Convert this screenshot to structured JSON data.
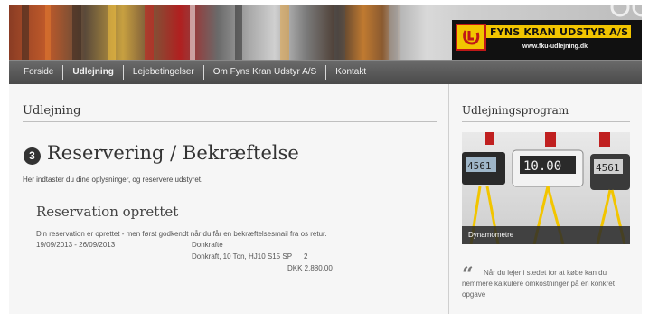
{
  "header": {
    "brand_name": "FYNS KRAN UDSTYR A/S",
    "brand_url": "www.fku-udlejning.dk"
  },
  "nav": {
    "items": [
      {
        "label": "Forside"
      },
      {
        "label": "Udlejning"
      },
      {
        "label": "Lejebetingelser"
      },
      {
        "label": "Om Fyns Kran Udstyr A/S"
      },
      {
        "label": "Kontakt"
      }
    ],
    "active": "Udlejning"
  },
  "main": {
    "section_title": "Udlejning",
    "step_number": "3",
    "step_heading": "Reservering / Bekræftelse",
    "intro": "Her indtaster du dine oplysninger, og reservere udstyret.",
    "confirmation_heading": "Reservation oprettet",
    "confirmation_text": "Din reservation er oprettet - men først godkendt når du får en bekræftelsesmail fra os retur.",
    "reservation": {
      "dates": "19/09/2013 - 26/09/2013",
      "category": "Donkrafte",
      "item": "Donkraft, 10 Ton, HJ10 S15 SP",
      "quantity": "2",
      "price": "DKK 2.880,00"
    }
  },
  "sidebar": {
    "title": "Udlejningsprogram",
    "promo": {
      "caption": "Dynamometre",
      "displays": [
        "4561",
        "10.00",
        "4561"
      ]
    },
    "quote": "Når du lejer i stedet for at købe kan du nemmere kalkulere omkostninger på en konkret opgave"
  },
  "colors": {
    "nav_bg": "#555555",
    "brand_yellow": "#f2c500",
    "brand_red": "#c01818",
    "page_bg": "#f6f6f6"
  }
}
